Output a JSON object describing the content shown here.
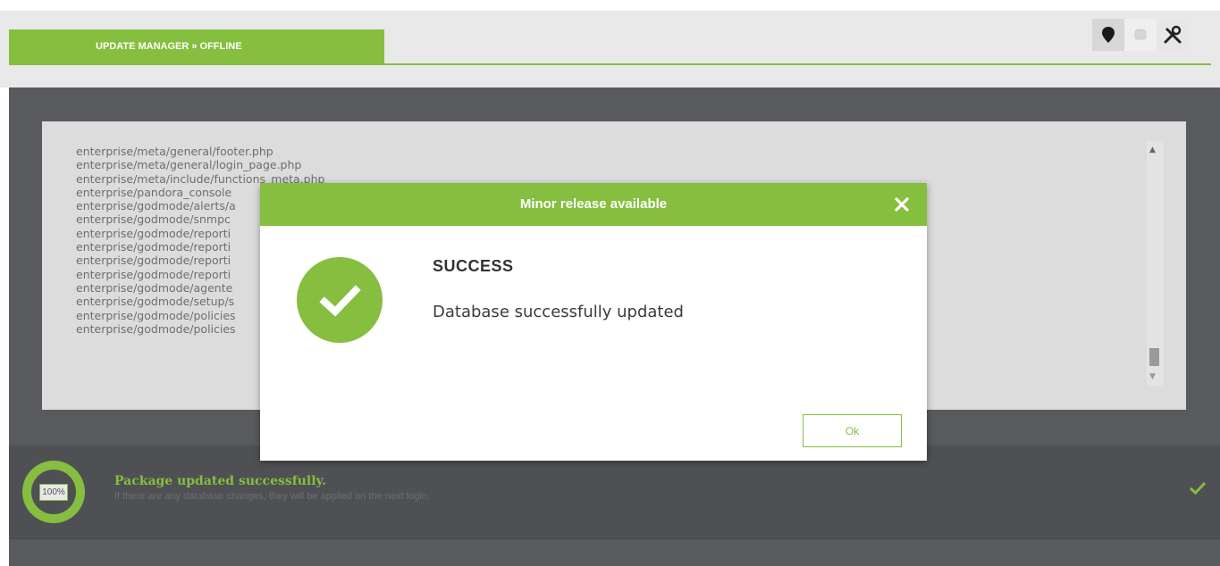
{
  "header": {
    "tab_label": "UPDATE MANAGER » OFFLINE",
    "tool_icons": [
      "map-pin-icon",
      "database-icon",
      "tools-icon"
    ]
  },
  "file_list": [
    "enterprise/meta/general/footer.php",
    "enterprise/meta/general/login_page.php",
    "enterprise/meta/include/functions_meta.php",
    "enterprise/pandora_console",
    "enterprise/godmode/alerts/a",
    "enterprise/godmode/snmpc",
    "enterprise/godmode/reporti",
    "enterprise/godmode/reporti",
    "enterprise/godmode/reporti",
    "enterprise/godmode/reporti",
    "enterprise/godmode/agente",
    "enterprise/godmode/setup/s",
    "enterprise/godmode/policies",
    "enterprise/godmode/policies"
  ],
  "status": {
    "progress_text": "100%",
    "progress_value": 1.0,
    "title": "Package updated successfully.",
    "subtitle": "If there are any database changes, they will be applied on the next login."
  },
  "modal": {
    "title": "Minor release available",
    "heading": "SUCCESS",
    "message": "Database successfully updated",
    "ok_label": "Ok"
  },
  "colors": {
    "accent": "#86be3f",
    "dark_bg": "#595a5e",
    "panel_bg": "#dcdcdc"
  }
}
